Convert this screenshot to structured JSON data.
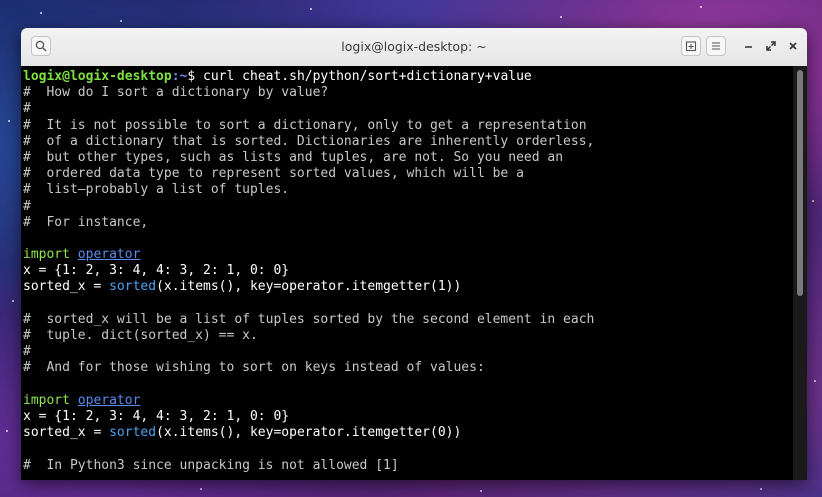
{
  "window": {
    "title": "logix@logix-desktop: ~"
  },
  "prompt": {
    "user_host": "logix@logix-desktop",
    "path": ":~",
    "symbol": "$ ",
    "command": "curl cheat.sh/python/sort+dictionary+value"
  },
  "lines": [
    "#  How do I sort a dictionary by value?",
    "#",
    "#  It is not possible to sort a dictionary, only to get a representation",
    "#  of a dictionary that is sorted. Dictionaries are inherently orderless,",
    "#  but other types, such as lists and tuples, are not. So you need an",
    "#  ordered data type to represent sorted values, which will be a",
    "#  list—probably a list of tuples.",
    "#",
    "#  For instance,",
    "",
    "",
    "",
    "",
    "",
    "#  sorted_x will be a list of tuples sorted by the second element in each",
    "#  tuple. dict(sorted_x) == x.",
    "#",
    "#  And for those wishing to sort on keys instead of values:",
    "",
    "",
    "",
    "",
    "",
    "#  In Python3 since unpacking is not allowed [1]"
  ],
  "code1": {
    "import_kw": "import",
    "module": "operator",
    "assign": "x = {1: 2, 3: 4, 4: 3, 2: 1, 0: 0}",
    "sorted_lhs": "sorted_x = ",
    "sorted_fn": "sorted",
    "sorted_rhs": "(x.items(), key=operator.itemgetter(1))"
  },
  "code2": {
    "import_kw": "import",
    "module": "operator",
    "assign": "x = {1: 2, 3: 4, 4: 3, 2: 1, 0: 0}",
    "sorted_lhs": "sorted_x = ",
    "sorted_fn": "sorted",
    "sorted_rhs": "(x.items(), key=operator.itemgetter(0))"
  },
  "icons": {
    "search": "search-icon",
    "new_tab": "new-tab-icon",
    "menu": "hamburger-menu-icon",
    "minimize": "minimize-icon",
    "maximize": "maximize-icon",
    "close": "close-icon"
  },
  "colors": {
    "prompt_user": "#7fe042",
    "prompt_path": "#6b8ff0",
    "keyword": "#8ee64a",
    "module": "#5a8cf0",
    "function": "#4aa3f0",
    "comment": "#c8c8c8",
    "background": "#000000"
  }
}
